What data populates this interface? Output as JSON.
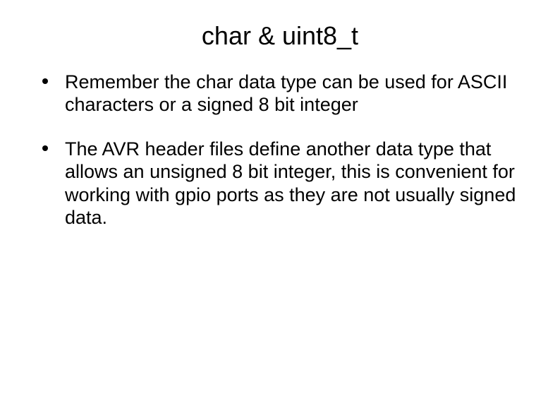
{
  "title": "char & uint8_t",
  "bullets": [
    "Remember the char data type can be used for ASCII characters or a signed 8 bit integer",
    "The AVR header files define another data type that allows an unsigned 8 bit integer, this is convenient for working with gpio ports as they are not usually signed data."
  ]
}
